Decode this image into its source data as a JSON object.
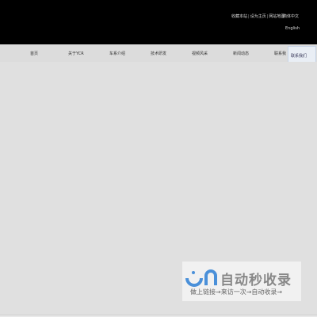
{
  "header": {
    "utility_links": [
      "收藏本站",
      "设为主页",
      "网站地图"
    ],
    "separator": "|",
    "lang_cn": "简体中文",
    "lang_en": "English"
  },
  "nav": {
    "items": [
      "首页",
      "关于YCR",
      "车系介绍",
      "技术研发",
      "视频风采",
      "新闻动态",
      "联系我"
    ],
    "active_tab": "联系我们"
  },
  "watermark": {
    "title": "自动秒收录",
    "subtitle": "做上链接→来访一次→自动收录→"
  },
  "colors": {
    "header_bg": "#000000",
    "nav_bg": "#dcdcdc",
    "body_bg": "#e0e0e0",
    "logo_blue": "#4a90d9"
  }
}
